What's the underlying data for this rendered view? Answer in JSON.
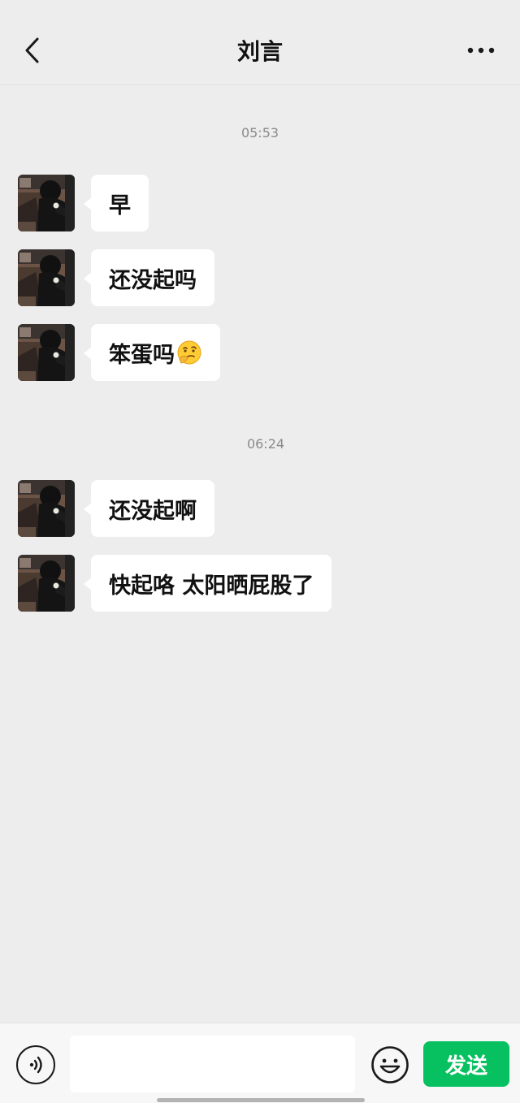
{
  "header": {
    "title": "刘言",
    "back_icon": "chevron-left-icon",
    "more_icon": "more-dots-icon"
  },
  "chat": {
    "groups": [
      {
        "timestamp": "05:53",
        "messages": [
          {
            "sender": "other",
            "text": "早"
          },
          {
            "sender": "other",
            "text": "还没起吗"
          },
          {
            "sender": "other",
            "text": "笨蛋吗",
            "emoji": "thinking-face"
          }
        ]
      },
      {
        "timestamp": "06:24",
        "messages": [
          {
            "sender": "other",
            "text": "还没起啊"
          },
          {
            "sender": "other",
            "text": "快起咯 太阳晒屁股了"
          }
        ]
      }
    ]
  },
  "inputbar": {
    "voice_icon": "voice-icon",
    "input_value": "",
    "emoji_icon": "emoji-smile-icon",
    "send_label": "发送"
  },
  "colors": {
    "background": "#ededed",
    "bubble": "#ffffff",
    "send_button": "#07c160"
  }
}
